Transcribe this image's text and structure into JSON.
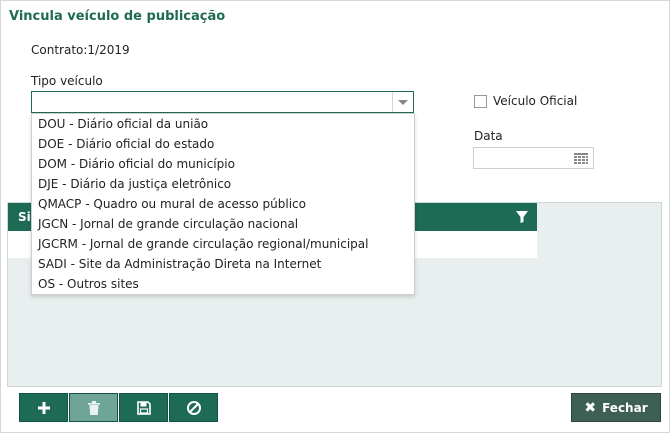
{
  "dialog": {
    "title": "Vincula veículo de publicação"
  },
  "form": {
    "contrato_text": "Contrato:1/2019",
    "tipo_label": "Tipo veículo",
    "tipo_value": "",
    "veiculo_oficial_label": "Veículo Oficial",
    "data_label": "Data",
    "data_value": ""
  },
  "grid": {
    "header_label": "Si"
  },
  "dropdown": {
    "options": [
      "DOU - Diário oficial da união",
      "DOE - Diário oficial do estado",
      "DOM - Diário oficial do município",
      "DJE - Diário da justiça eletrônico",
      "QMACP - Quadro ou mural de acesso público",
      "JGCN - Jornal de grande circulação nacional",
      "JGCRM - Jornal de grande circulação regional/municipal",
      "SADI - Site da Administração Direta na Internet",
      "OS - Outros sites"
    ]
  },
  "toolbar": {
    "add_icon": "plus-icon",
    "delete_icon": "trash-icon",
    "save_icon": "floppy-icon",
    "cancel_icon": "cancel-icon",
    "close_label": "Fechar"
  },
  "colors": {
    "primary": "#1e6b55",
    "close_button": "#3e5f55",
    "grid_bg": "#e8efee"
  }
}
